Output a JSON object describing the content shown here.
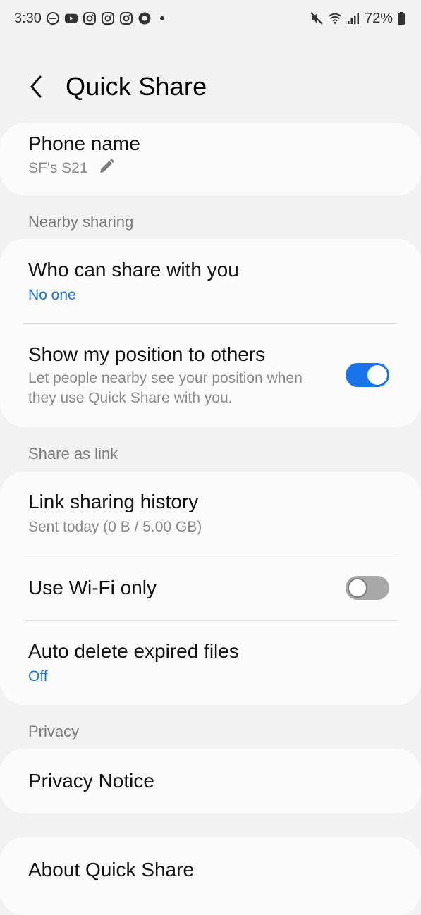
{
  "status_bar": {
    "time": "3:30",
    "left_icons": [
      "dnd-icon",
      "youtube-icon",
      "instagram-icon",
      "instagram-icon",
      "instagram-icon",
      "chrome-icon"
    ],
    "battery": "72%",
    "right_icons": [
      "mute-icon",
      "wifi-icon",
      "signal-icon",
      "battery-icon"
    ]
  },
  "header": {
    "title": "Quick Share",
    "back_icon": "chevron-left-icon"
  },
  "phone_name": {
    "title": "Phone name",
    "value": "SF's S21",
    "edit_icon": "pencil-icon"
  },
  "sections": {
    "nearby": "Nearby sharing",
    "link": "Share as link",
    "privacy": "Privacy"
  },
  "who_can_share": {
    "title": "Who can share with you",
    "value": "No one"
  },
  "show_position": {
    "title": "Show my position to others",
    "desc_line1": "Let people nearby see your position when",
    "desc_line2": "they use Quick Share with you.",
    "enabled": true
  },
  "link_history": {
    "title": "Link sharing history",
    "value": "Sent today (0 B / 5.00 GB)"
  },
  "wifi_only": {
    "title": "Use Wi-Fi only",
    "enabled": false
  },
  "auto_delete": {
    "title": "Auto delete expired files",
    "value": "Off"
  },
  "privacy_notice": {
    "title": "Privacy Notice"
  },
  "about": {
    "title": "About Quick Share"
  },
  "colors": {
    "accent": "#1a73e8",
    "link_blue": "#1a73d0",
    "background": "#f2f2f2",
    "card": "#fbfbfb"
  }
}
